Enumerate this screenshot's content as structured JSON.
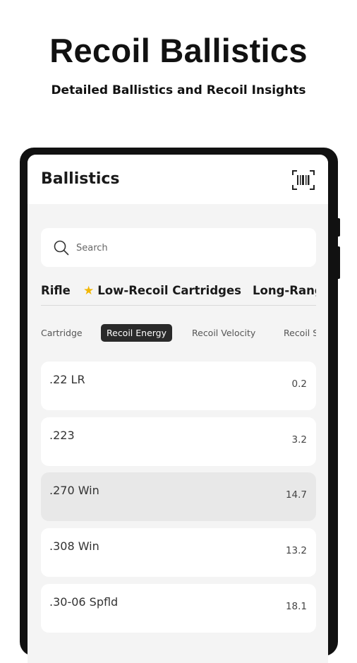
{
  "hero": {
    "title": "Recoil Ballistics",
    "subtitle": "Detailed Ballistics and Recoil Insights"
  },
  "app_bar": {
    "title": "Ballistics",
    "scan_icon": "barcode-scan-icon"
  },
  "search": {
    "placeholder": "Search",
    "value": "",
    "icon": "search-icon"
  },
  "categories": [
    {
      "label": "Rifle"
    },
    {
      "label": "Low-Recoil Cartridges",
      "icon": "star-icon"
    },
    {
      "label": "Long-Range"
    }
  ],
  "columns": [
    {
      "label": "Cartridge",
      "active": false
    },
    {
      "label": "Recoil Energy",
      "active": true
    },
    {
      "label": "Recoil Velocity",
      "active": false
    },
    {
      "label": "Recoil S",
      "active": false
    }
  ],
  "rows": [
    {
      "name": ".22 LR",
      "value": "0.2",
      "highlighted": false
    },
    {
      "name": ".223",
      "value": "3.2",
      "highlighted": false
    },
    {
      "name": ".270 Win",
      "value": "14.7",
      "highlighted": true
    },
    {
      "name": ".308 Win",
      "value": "13.2",
      "highlighted": false
    },
    {
      "name": ".30-06 Spfld",
      "value": "18.1",
      "highlighted": false
    }
  ],
  "colors": {
    "star": "#f2b705",
    "active_chip": "#2a2a2a",
    "highlight_row": "#e8e8e8",
    "screen_bg": "#f4f4f4"
  }
}
